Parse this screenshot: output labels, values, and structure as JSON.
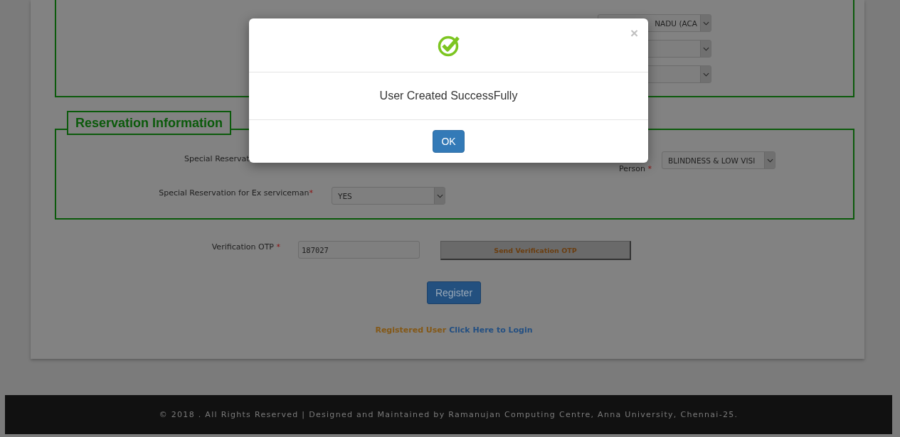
{
  "top_section": {
    "selects": [
      {
        "kind": "select",
        "value": "NADU (ACA"
      },
      {
        "kind": "select"
      },
      {
        "kind": "select"
      }
    ]
  },
  "reservation": {
    "legend": "Reservation Information",
    "covered_label": "Special Reservat",
    "fields": [
      {
        "label": "Person",
        "mark": "*",
        "value": "BLINDNESS & LOW VISI"
      },
      {
        "label": "Special Reservation for Ex serviceman",
        "mark": "*",
        "value": "YES"
      }
    ]
  },
  "otp": {
    "label": "Verification OTP",
    "mark": "*",
    "value": "187027",
    "send_button": "Send Verification OTP"
  },
  "register_button": "Register",
  "login_line": {
    "text": "Registered User",
    "link": "Click Here to Login"
  },
  "footer": "© 2018 . All Rights Reserved | Designed and Maintained by Ramanujan Computing Centre, Anna University, Chennai-25.",
  "dialog": {
    "close": "×",
    "message": "User Created SuccessFully",
    "ok_button": "OK"
  }
}
